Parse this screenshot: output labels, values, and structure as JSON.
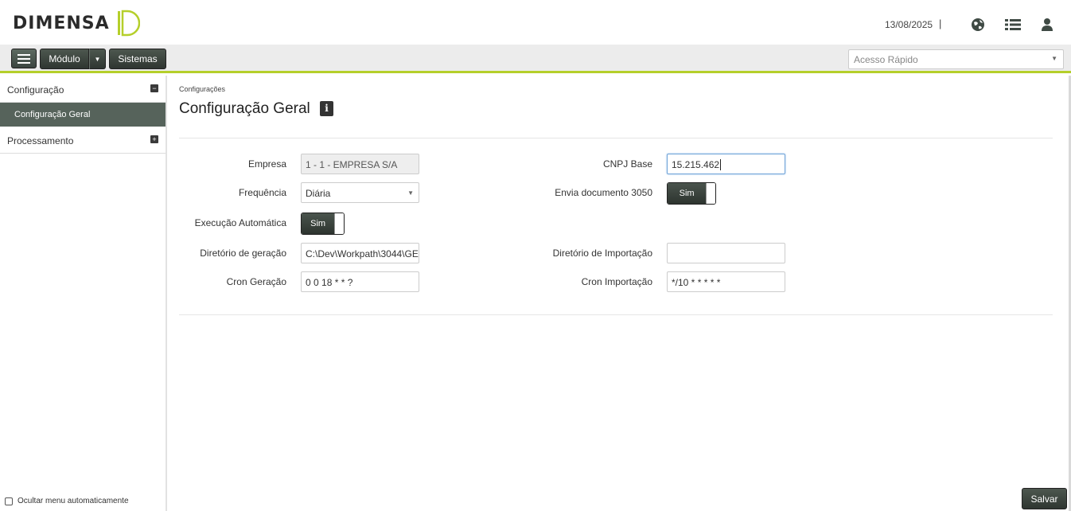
{
  "header": {
    "logo_text": "DIMENSA",
    "date": "13/08/2025",
    "separator": "|"
  },
  "toolbar": {
    "modulo_label": "Módulo",
    "sistemas_label": "Sistemas",
    "quick_access_placeholder": "Acesso Rápido"
  },
  "sidebar": {
    "items": [
      {
        "label": "Configuração",
        "toggle": "−",
        "expanded": true,
        "children": [
          {
            "label": "Configuração Geral",
            "active": true
          }
        ]
      },
      {
        "label": "Processamento",
        "toggle": "+",
        "expanded": false
      }
    ],
    "footer_label": "Ocultar menu automaticamente"
  },
  "page": {
    "breadcrumb": "Configurações",
    "title": "Configuração Geral",
    "info_icon": "i",
    "save_label": "Salvar"
  },
  "form": {
    "empresa_label": "Empresa",
    "empresa_value": "1 - 1 - EMPRESA S/A",
    "frequencia_label": "Frequência",
    "frequencia_value": "Diária",
    "execucao_label": "Execução Automática",
    "execucao_value": "Sim",
    "dir_geracao_label": "Diretório de geração",
    "dir_geracao_value": "C:\\Dev\\Workpath\\3044\\GE",
    "cron_geracao_label": "Cron Geração",
    "cron_geracao_value": "0 0 18 * * ?",
    "cnpj_label": "CNPJ Base",
    "cnpj_value": "15.215.462",
    "envia_label": "Envia documento 3050",
    "envia_value": "Sim",
    "dir_importacao_label": "Diretório de Importação",
    "dir_importacao_value": "",
    "cron_importacao_label": "Cron Importação",
    "cron_importacao_value": "*/10 * * * * *"
  },
  "colors": {
    "accent_line": "#b5cf2a",
    "dark_button": "#3b4540",
    "active_sidebar": "#56635b"
  }
}
